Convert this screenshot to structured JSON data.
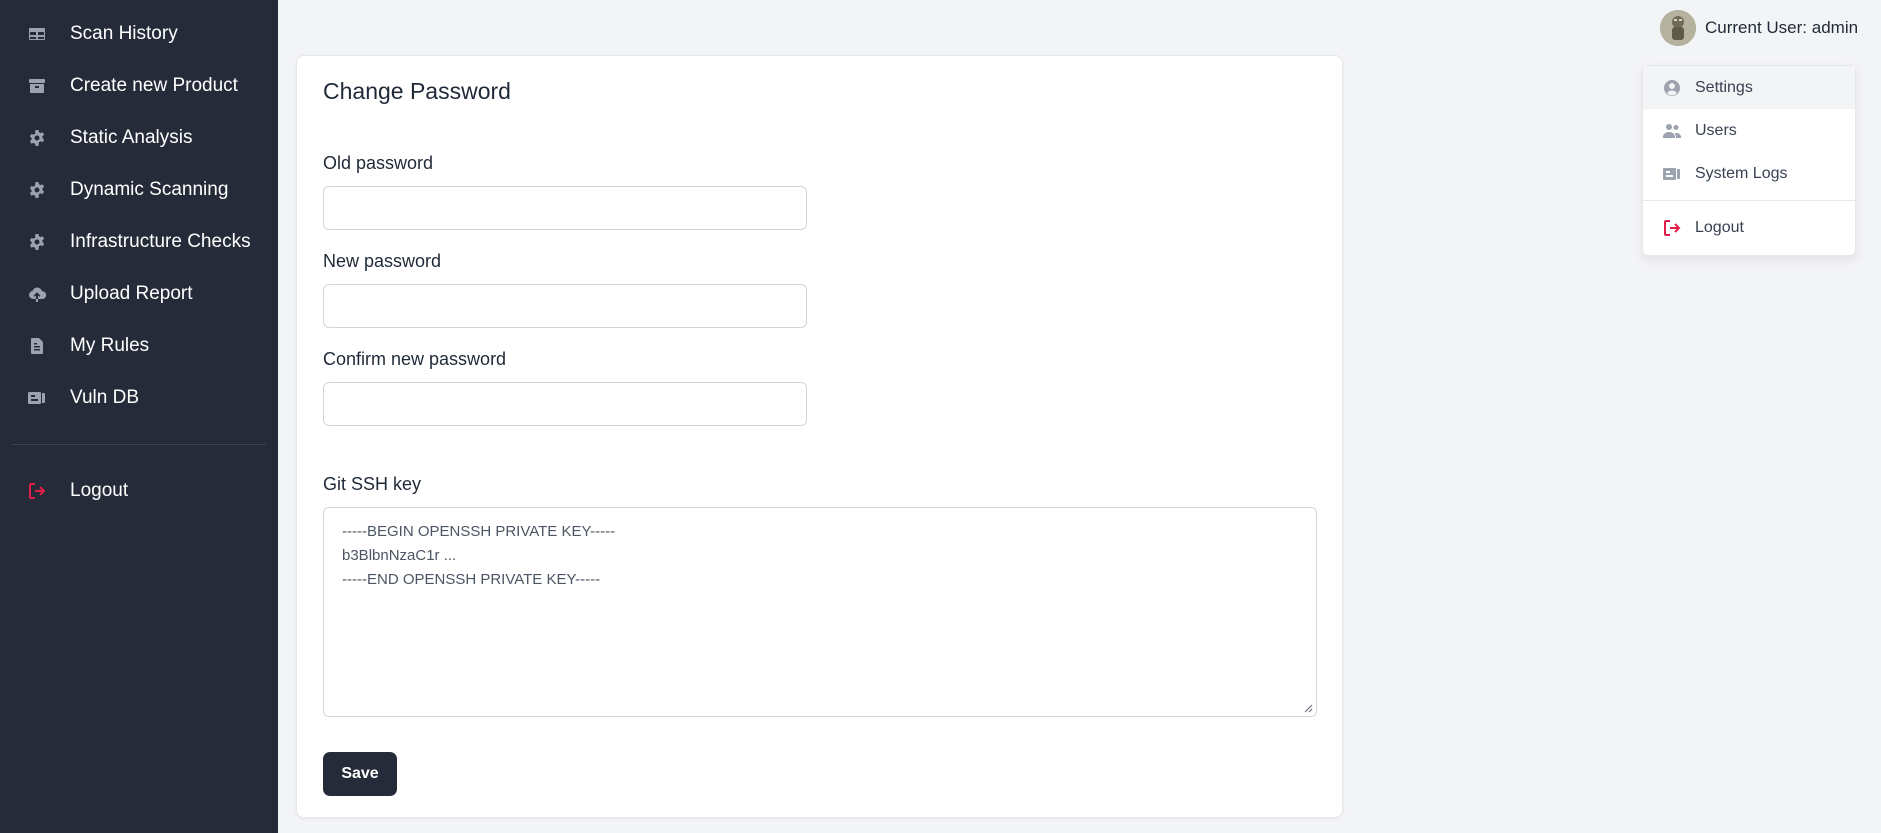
{
  "sidebar": {
    "items": [
      {
        "label": "Scan History",
        "icon": "table-icon"
      },
      {
        "label": "Create new Product",
        "icon": "archive-icon"
      },
      {
        "label": "Static Analysis",
        "icon": "gear-icon"
      },
      {
        "label": "Dynamic Scanning",
        "icon": "gear-icon"
      },
      {
        "label": "Infrastructure Checks",
        "icon": "gear-icon"
      },
      {
        "label": "Upload Report",
        "icon": "cloud-upload-icon"
      },
      {
        "label": "My Rules",
        "icon": "document-icon"
      },
      {
        "label": "Vuln DB",
        "icon": "database-icon"
      }
    ],
    "logout": {
      "label": "Logout",
      "icon": "logout-icon"
    }
  },
  "header": {
    "user_label": "Current User: admin"
  },
  "user_menu": {
    "items": [
      {
        "label": "Settings",
        "icon": "user-circle-icon"
      },
      {
        "label": "Users",
        "icon": "users-icon"
      },
      {
        "label": "System Logs",
        "icon": "logs-icon"
      }
    ],
    "logout": {
      "label": "Logout",
      "icon": "logout-icon"
    }
  },
  "form": {
    "title": "Change Password",
    "old_password": {
      "label": "Old password",
      "value": ""
    },
    "new_password": {
      "label": "New password",
      "value": ""
    },
    "confirm_password": {
      "label": "Confirm new password",
      "value": ""
    },
    "ssh_key": {
      "label": "Git SSH key",
      "lines": [
        "-----BEGIN OPENSSH PRIVATE KEY-----",
        "b3BlbnNzaC1r ...",
        "-----END OPENSSH PRIVATE KEY-----"
      ]
    },
    "save_label": "Save"
  },
  "colors": {
    "sidebar_bg": "#252b38",
    "page_bg": "#f3f4f6",
    "accent_logout": "#e11d48",
    "button_bg": "#252b38"
  }
}
